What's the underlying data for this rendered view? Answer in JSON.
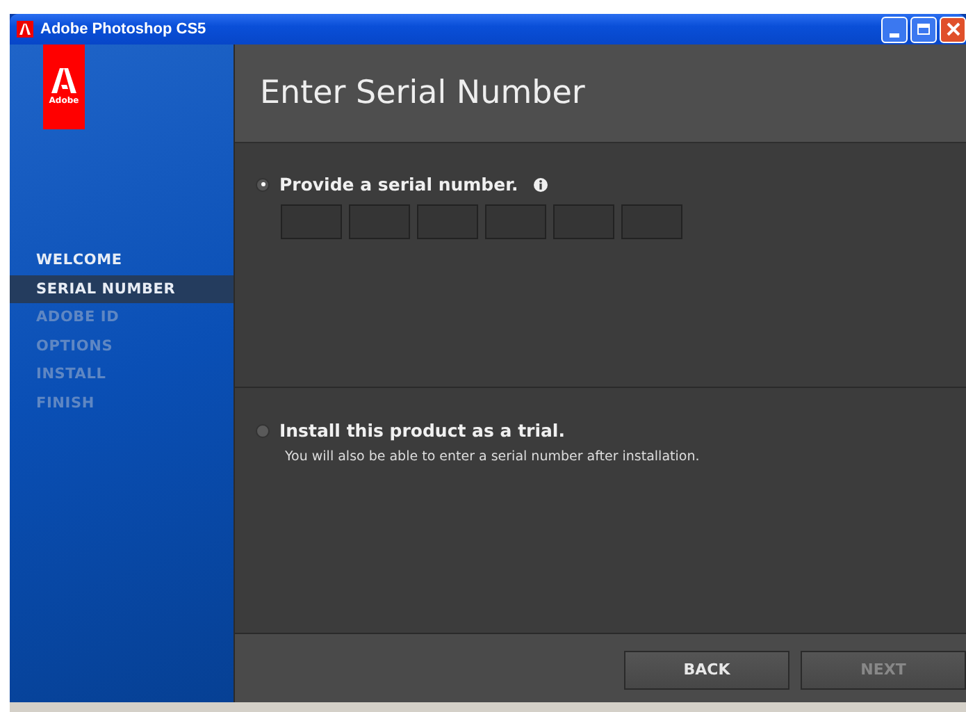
{
  "window": {
    "title": "Adobe Photoshop CS5"
  },
  "logo": {
    "label": "Adobe"
  },
  "sidebar": {
    "items": [
      {
        "label": "WELCOME",
        "selected": false,
        "disabled": false
      },
      {
        "label": "SERIAL NUMBER",
        "selected": true,
        "disabled": false
      },
      {
        "label": "ADOBE ID",
        "selected": false,
        "disabled": true
      },
      {
        "label": "OPTIONS",
        "selected": false,
        "disabled": true
      },
      {
        "label": "INSTALL",
        "selected": false,
        "disabled": true
      },
      {
        "label": "FINISH",
        "selected": false,
        "disabled": true
      }
    ]
  },
  "header": {
    "title": "Enter Serial Number"
  },
  "options": [
    {
      "kind": "serial",
      "label": "Provide a serial number.",
      "selected": true,
      "info": true
    },
    {
      "kind": "trial",
      "label": "Install this product as a trial.",
      "selected": false,
      "note": "You will also be able to enter a serial number after installation."
    }
  ],
  "buttons": [
    {
      "label": "BACK",
      "disabled": false
    },
    {
      "label": "NEXT",
      "disabled": true
    }
  ]
}
